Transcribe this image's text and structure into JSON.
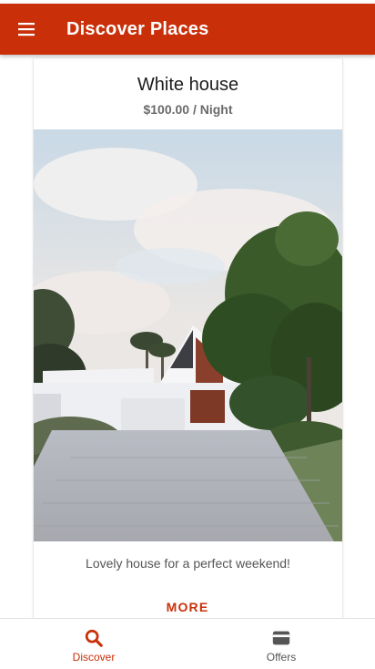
{
  "app_bar": {
    "title": "Discover Places",
    "menu_icon": "menu-icon",
    "background_color": "#c9300a",
    "title_color": "#ffffff"
  },
  "place": {
    "title": "White house",
    "price": "$100.00 / Night",
    "description": "Lovely house for a perfect weekend!",
    "more_label": "MORE",
    "image_alt": "Modern white house with a paved driveway and trees"
  },
  "tabs": [
    {
      "label": "Discover",
      "icon": "search-icon",
      "active": true
    },
    {
      "label": "Offers",
      "icon": "card-icon",
      "active": false
    }
  ],
  "colors": {
    "primary": "#c9300a",
    "inactive_tab": "#555555"
  }
}
